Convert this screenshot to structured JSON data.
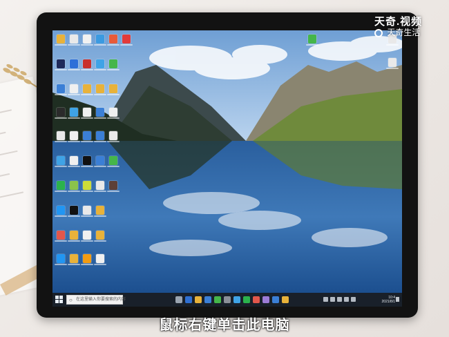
{
  "watermark": {
    "title": "天奇.视频",
    "logo_text": "天奇生活"
  },
  "subtitle": "鼠标右键单击此电脑",
  "taskbar": {
    "search_placeholder": "在这里输入你要搜索的内容",
    "clock_time": "10:4",
    "clock_date": "2021/8/1"
  },
  "colors": {
    "taskbar_bg": "#181c24",
    "monitor_bezel": "#121212",
    "sky": "#7fb0e0",
    "lake": "#1c5aa8"
  }
}
